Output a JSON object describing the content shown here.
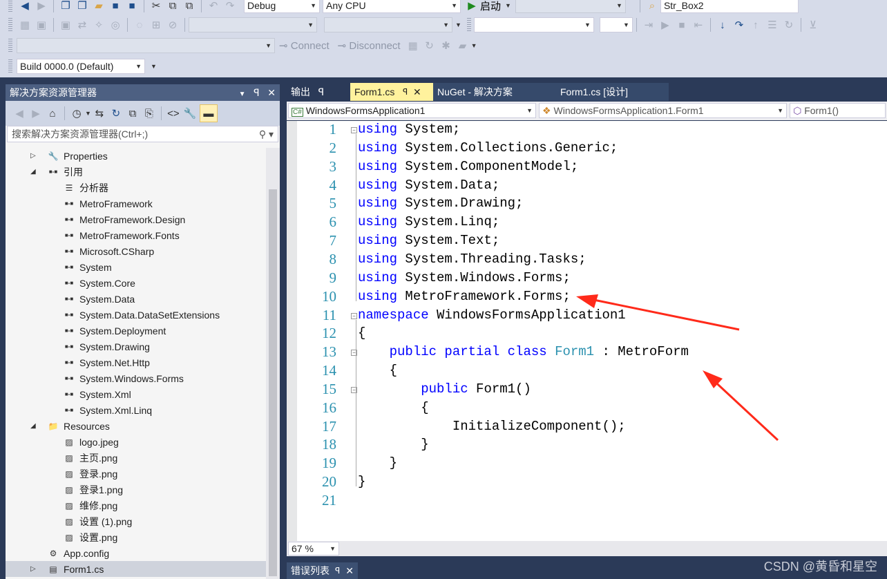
{
  "toolbar": {
    "config": "Debug",
    "platform": "Any CPU",
    "start_label": "启动",
    "search_value": "Str_Box2",
    "connect_label": "Connect",
    "disconnect_label": "Disconnect",
    "build_version": "Build 0000.0 (Default)"
  },
  "solution_explorer": {
    "title": "解决方案资源管理器",
    "search_placeholder": "搜索解决方案资源管理器(Ctrl+;)",
    "items": [
      {
        "label": "Properties",
        "level": 1,
        "icon": "wrench-icon",
        "expander": "collapsed"
      },
      {
        "label": "引用",
        "level": 1,
        "icon": "reference-icon",
        "expander": "expanded"
      },
      {
        "label": "分析器",
        "level": 2,
        "icon": "analyzer-icon"
      },
      {
        "label": "MetroFramework",
        "level": 2,
        "icon": "reference-icon"
      },
      {
        "label": "MetroFramework.Design",
        "level": 2,
        "icon": "reference-icon"
      },
      {
        "label": "MetroFramework.Fonts",
        "level": 2,
        "icon": "reference-icon"
      },
      {
        "label": "Microsoft.CSharp",
        "level": 2,
        "icon": "reference-icon"
      },
      {
        "label": "System",
        "level": 2,
        "icon": "reference-icon"
      },
      {
        "label": "System.Core",
        "level": 2,
        "icon": "reference-icon"
      },
      {
        "label": "System.Data",
        "level": 2,
        "icon": "reference-icon"
      },
      {
        "label": "System.Data.DataSetExtensions",
        "level": 2,
        "icon": "reference-icon"
      },
      {
        "label": "System.Deployment",
        "level": 2,
        "icon": "reference-icon"
      },
      {
        "label": "System.Drawing",
        "level": 2,
        "icon": "reference-icon"
      },
      {
        "label": "System.Net.Http",
        "level": 2,
        "icon": "reference-icon"
      },
      {
        "label": "System.Windows.Forms",
        "level": 2,
        "icon": "reference-icon"
      },
      {
        "label": "System.Xml",
        "level": 2,
        "icon": "reference-icon"
      },
      {
        "label": "System.Xml.Linq",
        "level": 2,
        "icon": "reference-icon"
      },
      {
        "label": "Resources",
        "level": 1,
        "icon": "folder-icon",
        "expander": "expanded"
      },
      {
        "label": "logo.jpeg",
        "level": 2,
        "icon": "image-icon"
      },
      {
        "label": "主页.png",
        "level": 2,
        "icon": "image-icon"
      },
      {
        "label": "登录.png",
        "level": 2,
        "icon": "image-icon"
      },
      {
        "label": "登录1.png",
        "level": 2,
        "icon": "image-icon"
      },
      {
        "label": "维修.png",
        "level": 2,
        "icon": "image-icon"
      },
      {
        "label": "设置 (1).png",
        "level": 2,
        "icon": "image-icon"
      },
      {
        "label": "设置.png",
        "level": 2,
        "icon": "image-icon"
      },
      {
        "label": "App.config",
        "level": 1,
        "icon": "config-icon"
      },
      {
        "label": "Form1.cs",
        "level": 1,
        "icon": "form-icon",
        "expander": "collapsed",
        "selected": true
      }
    ]
  },
  "tabs": [
    {
      "label": "输出",
      "pin": "ꟼ",
      "active": false
    },
    {
      "label": "Form1.cs",
      "active": true
    },
    {
      "label": "NuGet - 解决方案",
      "active": false
    },
    {
      "label": "Form1.cs [设计]",
      "active": false
    }
  ],
  "navbar": {
    "project": "WindowsFormsApplication1",
    "class": "WindowsFormsApplication1.Form1",
    "member": "Form1()"
  },
  "code": [
    [
      [
        "kw",
        "using"
      ],
      [
        "",
        "System;"
      ]
    ],
    [
      [
        "kw",
        "using"
      ],
      [
        "",
        "System.Collections.Generic;"
      ]
    ],
    [
      [
        "kw",
        "using"
      ],
      [
        "",
        "System.ComponentModel;"
      ]
    ],
    [
      [
        "kw",
        "using"
      ],
      [
        "",
        "System.Data;"
      ]
    ],
    [
      [
        "kw",
        "using"
      ],
      [
        "",
        "System.Drawing;"
      ]
    ],
    [
      [
        "kw",
        "using"
      ],
      [
        "",
        "System.Linq;"
      ]
    ],
    [
      [
        "kw",
        "using"
      ],
      [
        "",
        "System.Text;"
      ]
    ],
    [
      [
        "kw",
        "using"
      ],
      [
        "",
        "System.Threading.Tasks;"
      ]
    ],
    [
      [
        "kw",
        "using"
      ],
      [
        "",
        "System.Windows.Forms;"
      ]
    ],
    [
      [
        "kw",
        "using"
      ],
      [
        "",
        "MetroFramework.Forms;"
      ]
    ],
    [
      [
        "kw",
        "namespace"
      ],
      [
        "",
        "WindowsFormsApplication1"
      ]
    ],
    [
      [
        "",
        "{"
      ]
    ],
    [
      [
        "",
        "    "
      ],
      [
        "kw",
        "public partial class"
      ],
      [
        "",
        "",
        ""
      ],
      [
        "ty",
        "Form1"
      ],
      [
        "",
        " : MetroForm"
      ]
    ],
    [
      [
        "",
        "    {"
      ]
    ],
    [
      [
        "",
        "        "
      ],
      [
        "kw",
        "public"
      ],
      [
        "",
        " Form1()"
      ]
    ],
    [
      [
        "",
        "        {"
      ]
    ],
    [
      [
        "",
        "            InitializeComponent();"
      ]
    ],
    [
      [
        "",
        "        }"
      ]
    ],
    [
      [
        "",
        "    }"
      ]
    ],
    [
      [
        "",
        "}"
      ]
    ],
    []
  ],
  "zoom_level": "67 %",
  "bottom_tab": "错误列表",
  "watermark": "CSDN @黄昏和星空",
  "colors": {
    "keyword": "#0000ff",
    "type": "#2b91af",
    "line_number": "#2b91af",
    "annotation_arrow": "#ff2a1a"
  }
}
